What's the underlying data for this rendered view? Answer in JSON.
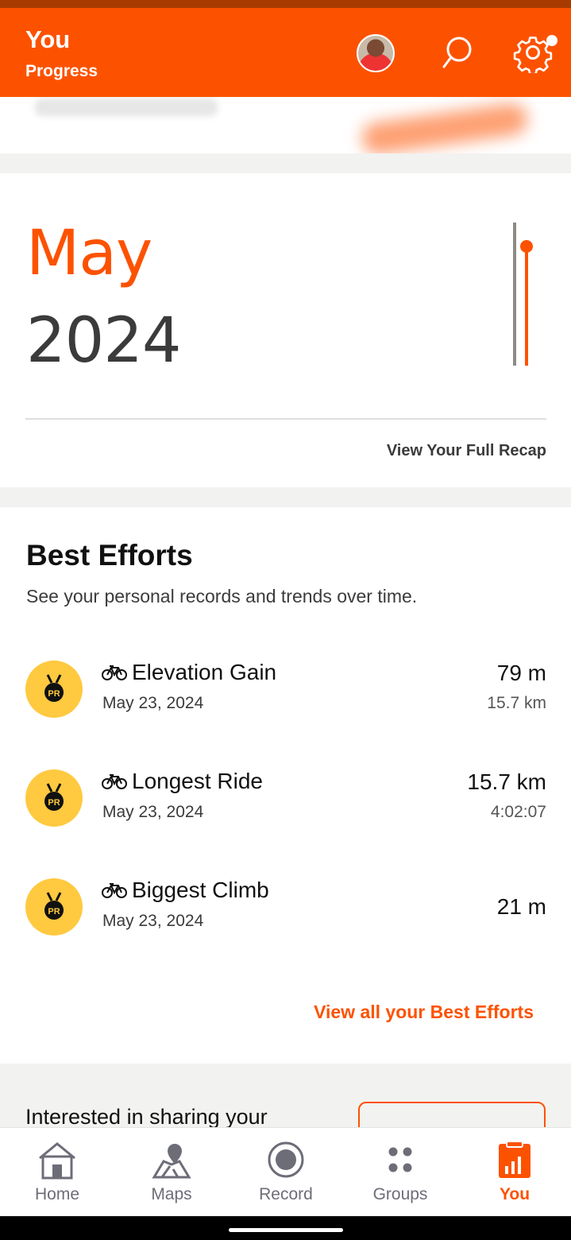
{
  "header": {
    "title": "You",
    "subtitle": "Progress",
    "icons": [
      "avatar",
      "search-icon",
      "gear-icon"
    ],
    "accent_color": "#fc5200"
  },
  "recap": {
    "month": "May",
    "year": "2024",
    "link": "View Your Full Recap"
  },
  "best_efforts": {
    "title": "Best Efforts",
    "subtitle": "See your personal records and trends over time.",
    "badge_text": "PR",
    "items": [
      {
        "name": "Elevation Gain",
        "date": "May 23, 2024",
        "value": "79 m",
        "sub": "15.7 km"
      },
      {
        "name": "Longest Ride",
        "date": "May 23, 2024",
        "value": "15.7 km",
        "sub": "4:02:07"
      },
      {
        "name": "Biggest Climb",
        "date": "May 23, 2024",
        "value": "21 m",
        "sub": ""
      }
    ],
    "view_all": "View all your Best Efforts"
  },
  "share": {
    "text": "Interested in sharing your"
  },
  "tabs": [
    {
      "label": "Home",
      "icon": "home-icon"
    },
    {
      "label": "Maps",
      "icon": "map-icon"
    },
    {
      "label": "Record",
      "icon": "record-icon"
    },
    {
      "label": "Groups",
      "icon": "groups-icon"
    },
    {
      "label": "You",
      "icon": "you-icon",
      "active": true
    }
  ]
}
